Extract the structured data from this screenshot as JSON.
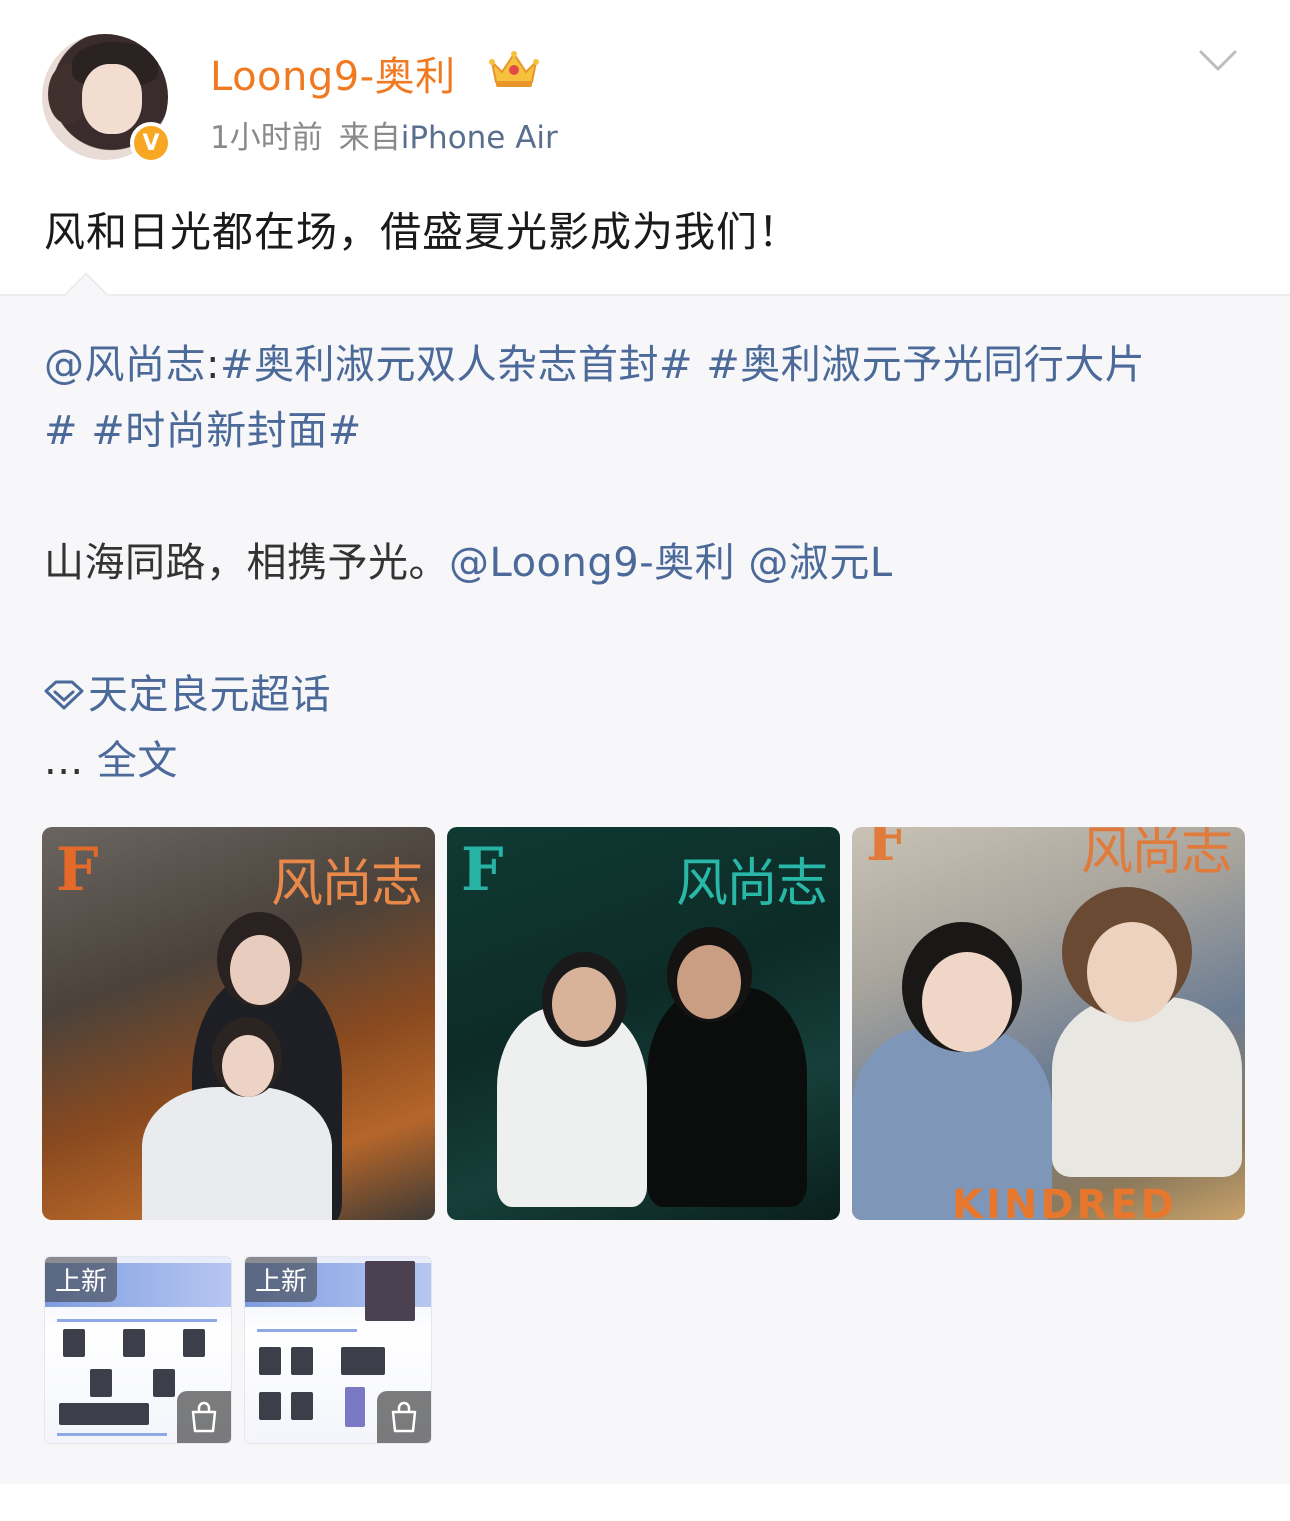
{
  "post": {
    "username": "Loong9-奥利",
    "time": "1小时前",
    "source_prefix": "来自",
    "source_device": "iPhone Air",
    "text": "风和日光都在场，借盛夏光影成为我们！"
  },
  "repost": {
    "mention": "@风尚志",
    "colon": ":",
    "topics_line1": "#奥利淑元双人杂志首封# #奥利淑元予光同行大片",
    "topics_line2": "# #时尚新封面#",
    "body_text": "山海同路，相携予光。",
    "mention_author": "@Loong9-奥利",
    "mention_other": "@淑元L",
    "supertopic": "天定良元超话",
    "ellipsis": "...",
    "full_text_link": "全文"
  },
  "images": [
    {
      "letter": "F",
      "masthead": "风尚志"
    },
    {
      "letter": "F",
      "masthead": "风尚志"
    },
    {
      "letter": "F",
      "masthead": "风尚志",
      "caption": "KINDRED"
    }
  ],
  "shop_items": [
    {
      "tag": "上新"
    },
    {
      "tag": "上新"
    }
  ],
  "colors": {
    "username": "#f07a22",
    "link": "#4c6a99",
    "meta": "#8a8a8a",
    "repost_bg": "#f7f7f9"
  },
  "icons": [
    "crown-badge-icon",
    "verified-v-icon",
    "chevron-down-icon",
    "supertopic-diamond-icon",
    "shopping-bag-icon"
  ]
}
